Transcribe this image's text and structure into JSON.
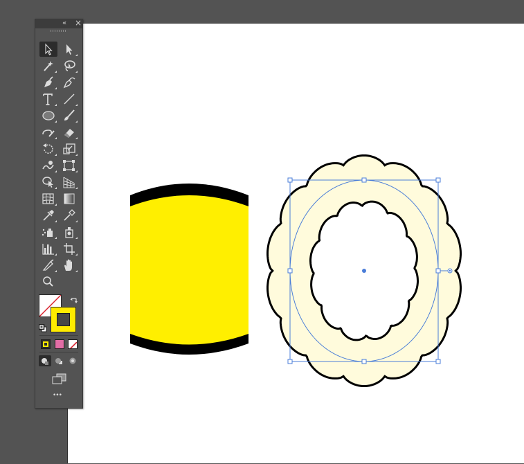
{
  "app": {
    "canvas_bg": "#535353",
    "artboard_bg": "#ffffff",
    "accent_selection": "#4a7dd8"
  },
  "toolbar": {
    "collapse_glyph": "«",
    "close_glyph": "×",
    "more_glyph": "•••",
    "tools": [
      "selection-tool",
      "direct-selection-tool",
      "magic-wand-tool",
      "lasso-tool",
      "pen-tool",
      "curvature-tool",
      "type-tool",
      "line-segment-tool",
      "ellipse-tool",
      "paintbrush-tool",
      "shaper-tool",
      "eraser-tool",
      "rotate-tool",
      "scale-tool",
      "warp-tool",
      "free-transform-tool",
      "shape-builder-tool",
      "perspective-grid-tool",
      "mesh-tool",
      "gradient-tool",
      "eyedropper-tool",
      "color-picker-tool",
      "symbol-sprayer-tool",
      "symbol-tool",
      "column-graph-tool",
      "artboard-tool",
      "slice-tool",
      "hand-tool",
      "zoom-tool"
    ],
    "fill": {
      "state": "none"
    },
    "stroke": {
      "color": "#ffeb00",
      "inner_color": "#474747"
    },
    "colors": {
      "yellow": "#ffeb00",
      "pink": "#e26ea6",
      "none_red": "#d9232e"
    }
  },
  "artwork": {
    "barrel_fill": "#ffef00",
    "barrel_stroke": "#000000",
    "frame_fill": "#fffbdc",
    "frame_stroke": "#000000"
  }
}
